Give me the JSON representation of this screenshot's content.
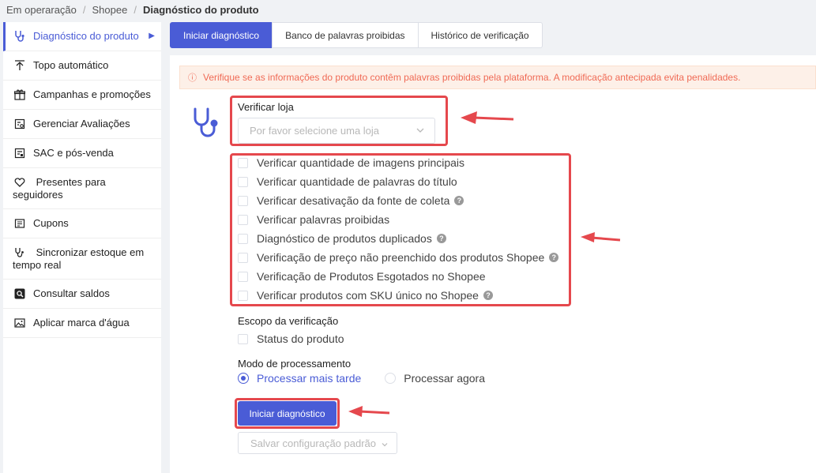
{
  "breadcrumb": {
    "items": [
      "Em operaração",
      "Shopee",
      "Diagnóstico do produto"
    ]
  },
  "sidebar": {
    "items": [
      {
        "label": "Diagnóstico do produto",
        "icon": "stethoscope-icon"
      },
      {
        "label": "Topo automático",
        "icon": "arrow-up-icon"
      },
      {
        "label": "Campanhas e promoções",
        "icon": "gift-icon"
      },
      {
        "label": "Gerenciar Avaliações",
        "icon": "review-icon"
      },
      {
        "label": "SAC e pós-venda",
        "icon": "service-icon"
      },
      {
        "label": "Presentes para seguidores",
        "icon": "heart-icon"
      },
      {
        "label": "Cupons",
        "icon": "coupon-icon"
      },
      {
        "label": "Sincronizar estoque em tempo real",
        "icon": "sync-stock-icon"
      },
      {
        "label": "Consultar saldos",
        "icon": "balance-icon"
      },
      {
        "label": "Aplicar marca d'água",
        "icon": "watermark-icon"
      }
    ]
  },
  "tabs": [
    {
      "label": "Iniciar diagnóstico",
      "active": true
    },
    {
      "label": "Banco de palavras proibidas",
      "active": false
    },
    {
      "label": "Histórico de verificação",
      "active": false
    }
  ],
  "alert": {
    "text": "Verifique se as informações do produto contêm palavras proibidas pela plataforma. A modificação antecipada evita penalidades."
  },
  "store": {
    "label": "Verificar loja",
    "placeholder": "Por favor selecione uma loja"
  },
  "checks": [
    {
      "label": "Verificar quantidade de imagens principais",
      "help": false
    },
    {
      "label": "Verificar quantidade de palavras do título",
      "help": false
    },
    {
      "label": "Verificar desativação da fonte de coleta",
      "help": true
    },
    {
      "label": "Verificar palavras proibidas",
      "help": false
    },
    {
      "label": "Diagnóstico de produtos duplicados",
      "help": true
    },
    {
      "label": "Verificação de preço não preenchido dos produtos Shopee",
      "help": true
    },
    {
      "label": "Verificação de Produtos Esgotados no Shopee",
      "help": false
    },
    {
      "label": "Verificar produtos com SKU único no Shopee",
      "help": true
    }
  ],
  "scope": {
    "label": "Escopo da verificação",
    "option": "Status do produto"
  },
  "mode": {
    "label": "Modo de processamento",
    "later": "Processar mais tarde",
    "now": "Processar agora",
    "selected": "later"
  },
  "buttons": {
    "start": "Iniciar diagnóstico",
    "save": "Salvar configuração padrão"
  },
  "colors": {
    "accent": "#4a5cd6",
    "alert_text": "#f06a55",
    "alert_bg": "#fdf0e8",
    "annotation": "#e5484d"
  }
}
